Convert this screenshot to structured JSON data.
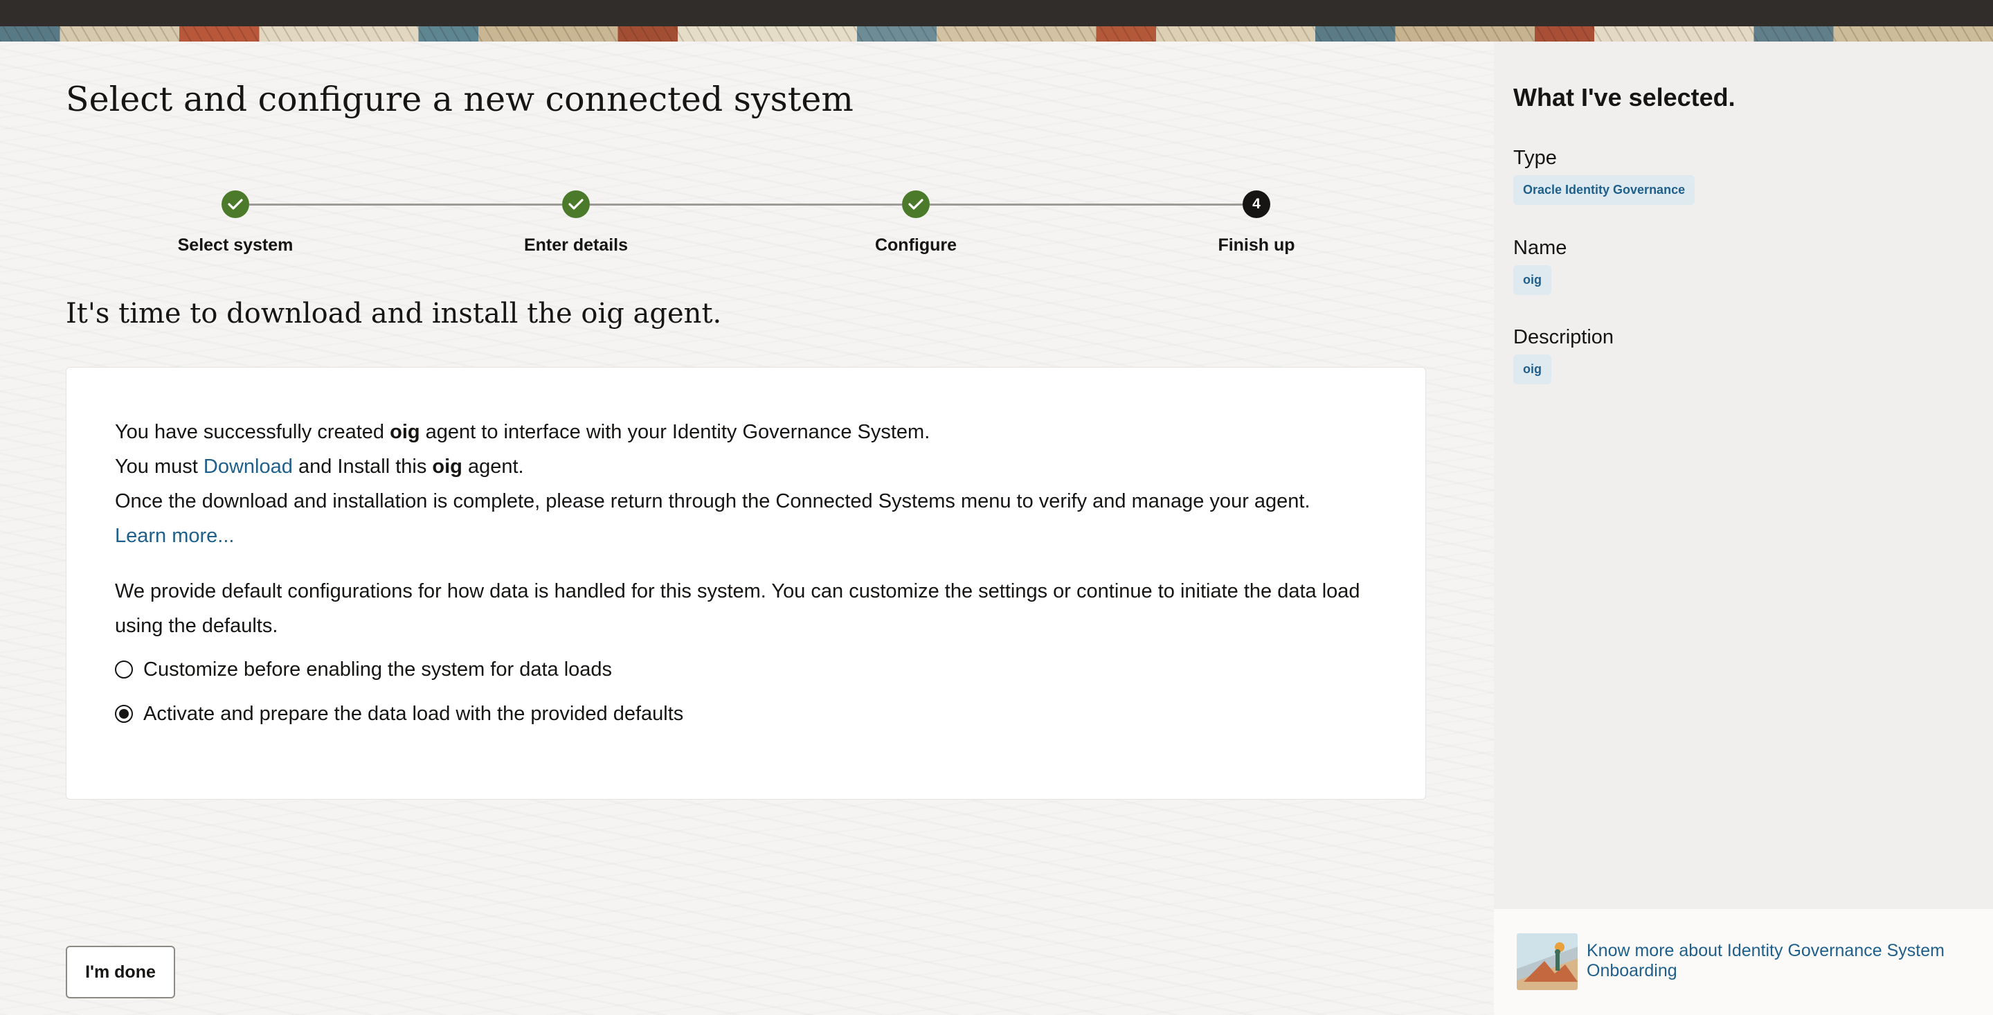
{
  "header": {
    "page_title": "Select and configure a new connected system"
  },
  "stepper": {
    "steps": [
      {
        "label": "Select system",
        "status": "complete"
      },
      {
        "label": "Enter details",
        "status": "complete"
      },
      {
        "label": "Configure",
        "status": "complete"
      },
      {
        "label": "Finish up",
        "status": "current",
        "number": "4"
      }
    ]
  },
  "main": {
    "section_title": "It's time to download and install the oig agent.",
    "card": {
      "line1_prefix": "You have successfully created ",
      "line1_bold": "oig",
      "line1_suffix": " agent to interface with your Identity Governance System.",
      "line2_prefix": "You must ",
      "line2_link": "Download",
      "line2_middle": " and Install this ",
      "line2_bold": "oig",
      "line2_suffix": " agent.",
      "line3": "Once the download and installation is complete, please return through the Connected Systems menu to verify and manage your agent.",
      "learn_more": "Learn more...",
      "defaults_text": "We provide default configurations for how data is handled for this system. You can customize the settings or continue to initiate the data load using the defaults.",
      "options": [
        {
          "label": "Customize before enabling the system for data loads",
          "selected": false
        },
        {
          "label": "Activate and prepare the data load with the provided defaults",
          "selected": true
        }
      ]
    },
    "done_button": "I'm done"
  },
  "sidebar": {
    "title": "What I've selected.",
    "type_label": "Type",
    "type_value": "Oracle Identity Governance",
    "name_label": "Name",
    "name_value": "oig",
    "description_label": "Description",
    "description_value": "oig",
    "footer_link": "Know more about Identity Governance System Onboarding"
  },
  "colors": {
    "complete_step": "#4b7b2a",
    "current_step": "#161513",
    "link": "#1f5f8b",
    "badge_bg": "#dfeaf0"
  }
}
